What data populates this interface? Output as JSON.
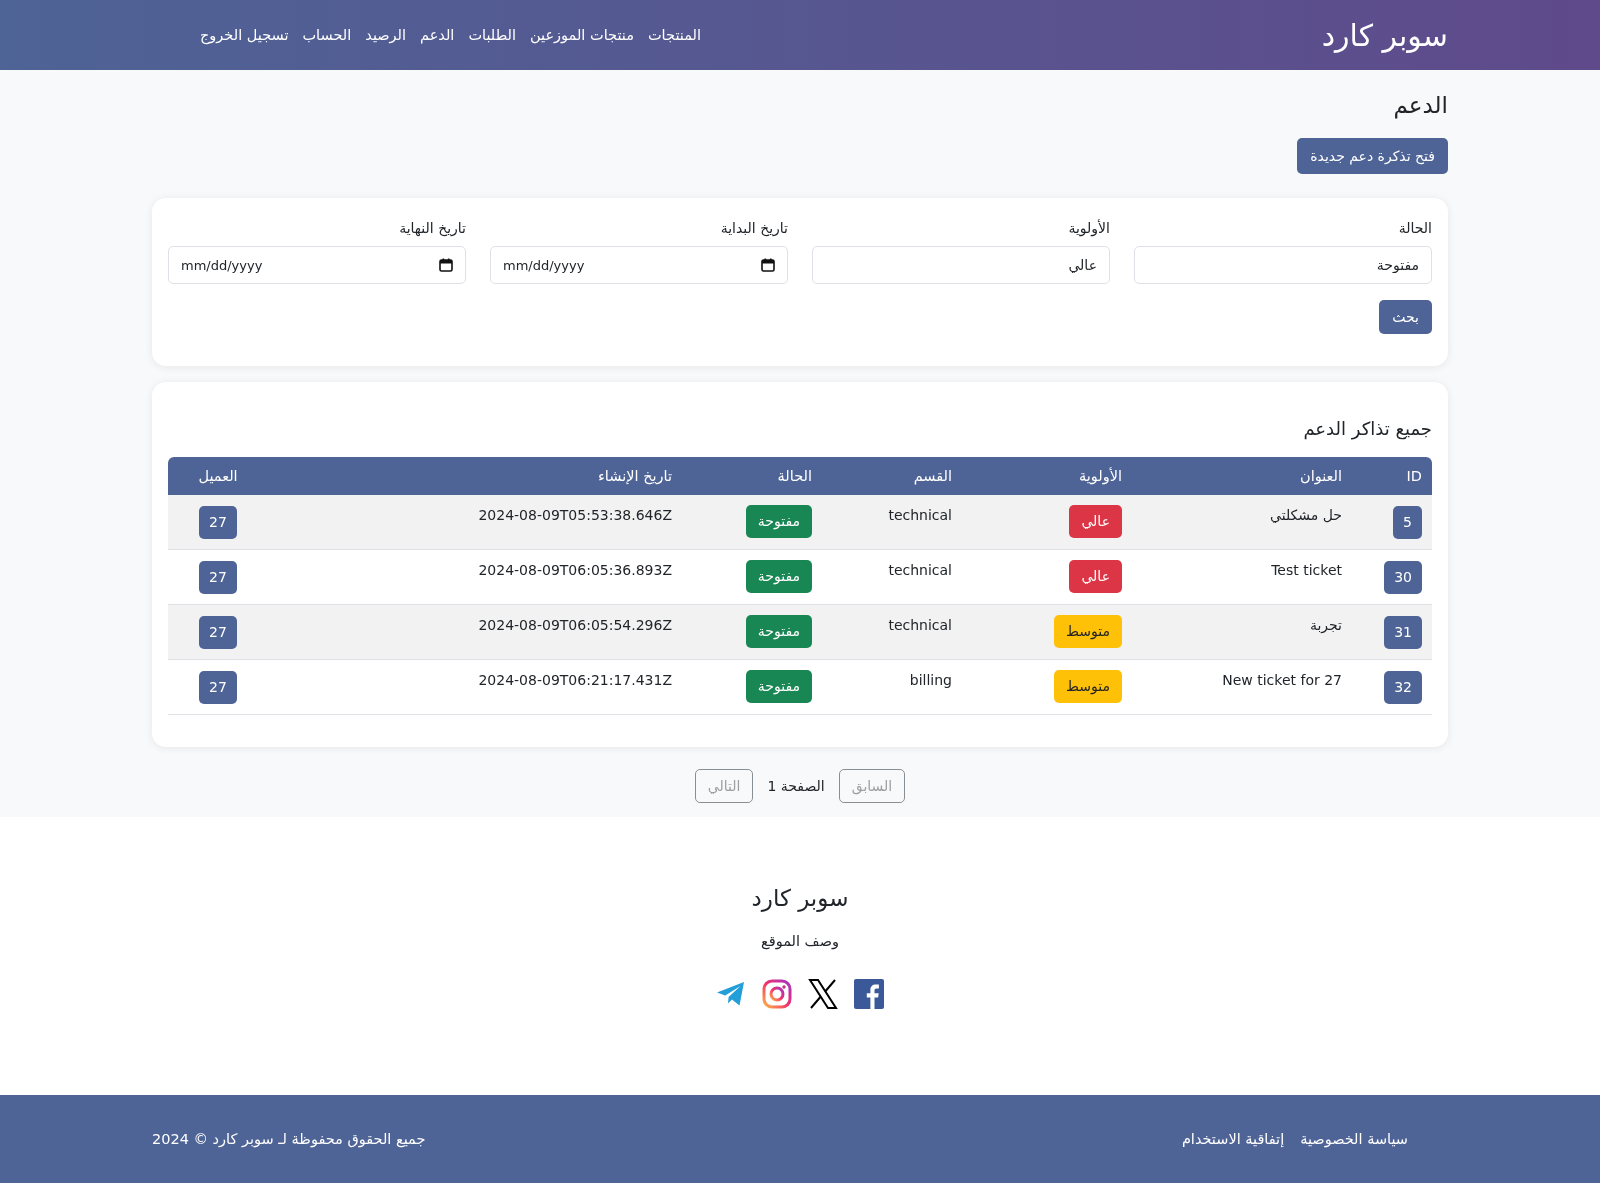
{
  "navbar": {
    "brand": "سوبر كارد",
    "links": [
      "المنتجات",
      "منتجات الموزعين",
      "الطلبات",
      "الدعم",
      "الرصيد",
      "الحساب",
      "تسجيل الخروج"
    ]
  },
  "page_title": "الدعم",
  "new_ticket_button": "فتح تذكرة دعم جديدة",
  "filters": {
    "fields": [
      {
        "kind": "text",
        "label": "الحالة",
        "value": "مفتوحة"
      },
      {
        "kind": "text",
        "label": "الأولوية",
        "value": "عالي"
      },
      {
        "kind": "date",
        "label": "تاريخ البداية",
        "placeholder": "mm/dd/yyyy"
      },
      {
        "kind": "date",
        "label": "تاريخ النهاية",
        "placeholder": "mm/dd/yyyy"
      }
    ],
    "search_button": "بحث"
  },
  "tickets": {
    "title": "جميع تذاكر الدعم",
    "columns": [
      "ID",
      "العنوان",
      "الأولوية",
      "القسم",
      "الحالة",
      "تاريخ الإنشاء",
      "العميل"
    ],
    "rows": [
      {
        "id": "5",
        "title": "حل مشكلتي",
        "priority": {
          "text": "عالي",
          "color": "#dc3545"
        },
        "department": "technical",
        "status": {
          "text": "مفتوحة",
          "color": "#198754"
        },
        "created": "2024-08-09T05:53:38.646Z",
        "customer": "27"
      },
      {
        "id": "30",
        "title": "Test ticket",
        "priority": {
          "text": "عالي",
          "color": "#dc3545"
        },
        "department": "technical",
        "status": {
          "text": "مفتوحة",
          "color": "#198754"
        },
        "created": "2024-08-09T06:05:36.893Z",
        "customer": "27"
      },
      {
        "id": "31",
        "title": "تجربة",
        "priority": {
          "text": "متوسط",
          "color": "#ffc107"
        },
        "department": "technical",
        "status": {
          "text": "مفتوحة",
          "color": "#198754"
        },
        "created": "2024-08-09T06:05:54.296Z",
        "customer": "27"
      },
      {
        "id": "32",
        "title": "New ticket for 27",
        "priority": {
          "text": "متوسط",
          "color": "#ffc107"
        },
        "department": "billing",
        "status": {
          "text": "مفتوحة",
          "color": "#198754"
        },
        "created": "2024-08-09T06:21:17.431Z",
        "customer": "27"
      }
    ]
  },
  "pagination": {
    "previous": {
      "label": "السابق",
      "disabled": true
    },
    "page": "الصفحة 1",
    "next": {
      "label": "التالي",
      "disabled": true
    }
  },
  "footer": {
    "brand": "سوبر كارد",
    "description": "وصف الموقع",
    "social": [
      {
        "kind": "facebook"
      },
      {
        "kind": "x"
      },
      {
        "kind": "instagram"
      },
      {
        "kind": "telegram"
      }
    ],
    "links": [
      "سياسة الخصوصية",
      "إتفاقية الاستخدام"
    ],
    "copyright": "جميع الحقوق محفوظة لـ سوبر كارد © 2024"
  }
}
